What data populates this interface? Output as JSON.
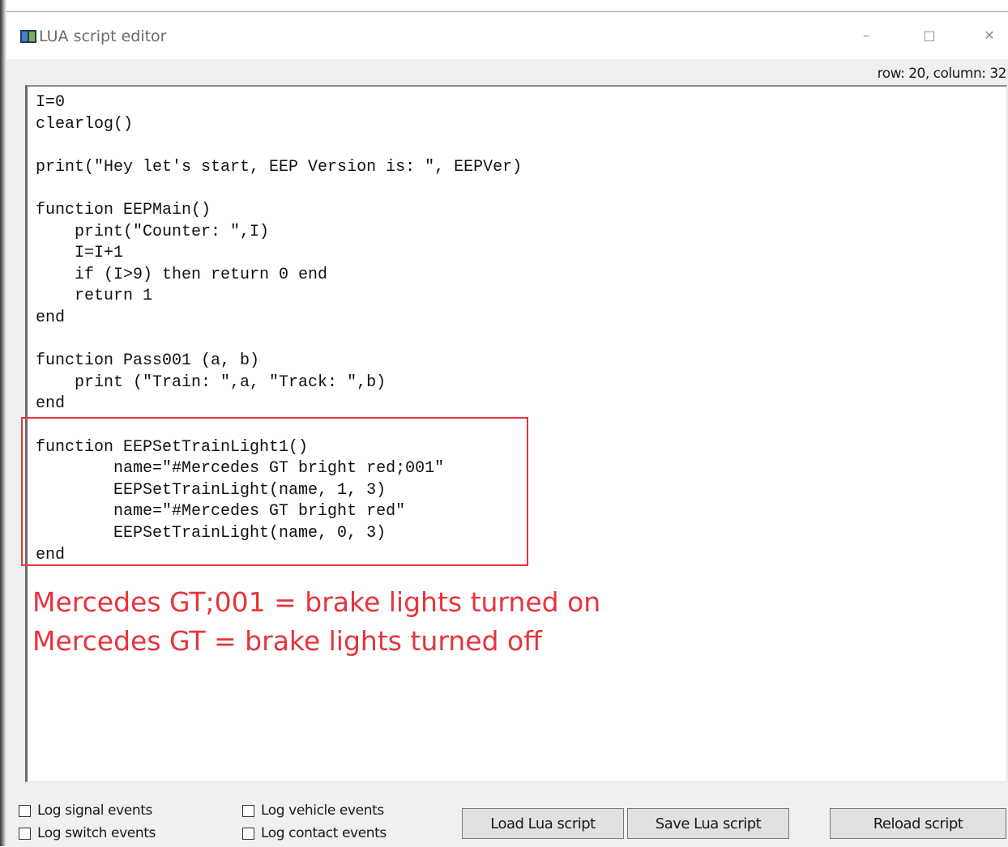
{
  "window": {
    "title": "LUA script editor",
    "controls": {
      "minimize": "–",
      "maximize": "□",
      "close": "✕"
    }
  },
  "status": {
    "cursor_position": "row: 20, column: 32"
  },
  "editor": {
    "lines": [
      "I=0",
      "clearlog()",
      "",
      "print(\"Hey let's start, EEP Version is: \", EEPVer)",
      "",
      "function EEPMain()",
      "    print(\"Counter: \",I)",
      "    I=I+1",
      "    if (I>9) then return 0 end",
      "    return 1",
      "end",
      "",
      "function Pass001 (a, b)",
      "    print (\"Train: \",a, \"Track: \",b)",
      "end",
      "",
      "function EEPSetTrainLight1()",
      "        name=\"#Mercedes GT bright red;001\"",
      "        EEPSetTrainLight(name, 1, 3)",
      "        name=\"#Mercedes GT bright red\"",
      "        EEPSetTrainLight(name, 0, 3)",
      "end"
    ]
  },
  "annotation": {
    "color": "#e8343c",
    "lines": [
      "Mercedes GT;001 = brake lights turned on",
      "Mercedes GT = brake lights turned off"
    ]
  },
  "options": {
    "log_signal_events": {
      "label": "Log signal events",
      "checked": false
    },
    "log_switch_events": {
      "label": "Log switch events",
      "checked": false
    },
    "log_vehicle_events": {
      "label": "Log vehicle events",
      "checked": false
    },
    "log_contact_events": {
      "label": "Log contact events",
      "checked": false
    }
  },
  "buttons": {
    "load": "Load Lua script",
    "save": "Save Lua script",
    "reload": "Reload script"
  }
}
